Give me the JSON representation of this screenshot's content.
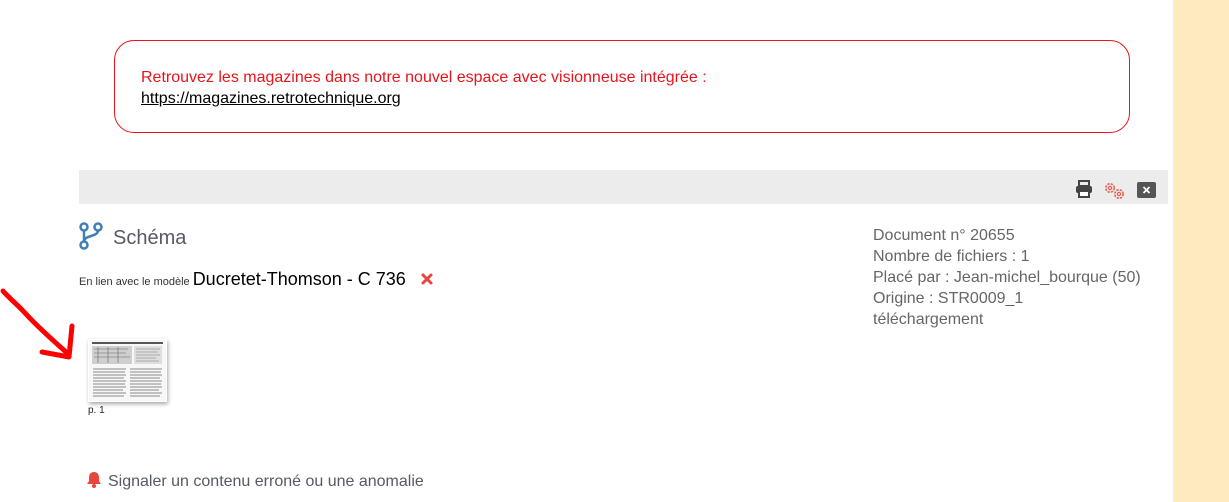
{
  "notice": {
    "text": "Retrouvez les magazines dans notre nouvel espace avec visionneuse intégrée :",
    "link": "https://magazines.retrotechnique.org"
  },
  "toolbar": {
    "icons": [
      "print-icon",
      "settings-gears-icon",
      "close-icon"
    ]
  },
  "document": {
    "type_title": "Schéma",
    "link_prefix": "En lien avec le modèle",
    "model_name": "Ducretet-Thomson - C 736",
    "info": {
      "number": "Document n° 20655",
      "file_count": "Nombre de fichiers : 1",
      "placed_by": "Placé par : Jean-michel_bourque (50)",
      "origin": "Origine : STR0009_1",
      "download": "téléchargement"
    }
  },
  "pages": [
    {
      "caption": "p. 1"
    }
  ],
  "report": {
    "label": "Signaler un contenu erroné ou une anomalie"
  },
  "colors": {
    "notice_red": "#e8141b",
    "side_strip": "#fdebbf",
    "toolbar_bg": "#ececec",
    "branch_icon": "#3d7fb6",
    "annotation_arrow": "#ff0000"
  }
}
